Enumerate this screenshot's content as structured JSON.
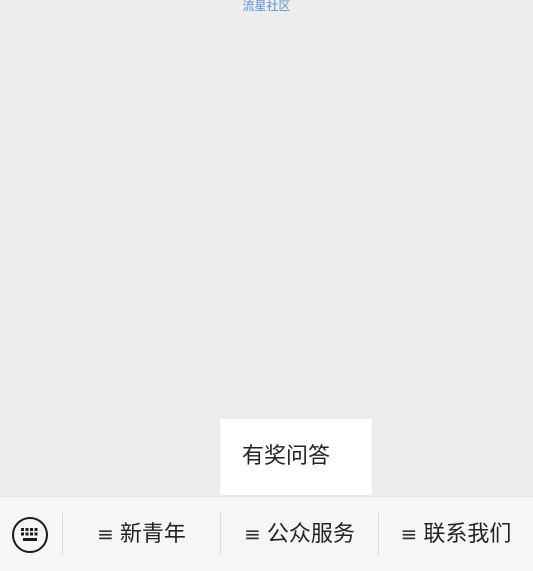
{
  "header": {
    "source_link": "流星社区"
  },
  "submenu": {
    "items": [
      {
        "label": "有奖问答"
      }
    ]
  },
  "bottom_menu": {
    "keyboard_icon": "keyboard-icon",
    "menu_glyph": "≡",
    "tabs": [
      {
        "label": "新青年"
      },
      {
        "label": "公众服务"
      },
      {
        "label": "联系我们"
      }
    ]
  },
  "colors": {
    "background": "#ededed",
    "bar_background": "#f6f6f6",
    "link": "#5b8fd6",
    "text": "#222222"
  }
}
